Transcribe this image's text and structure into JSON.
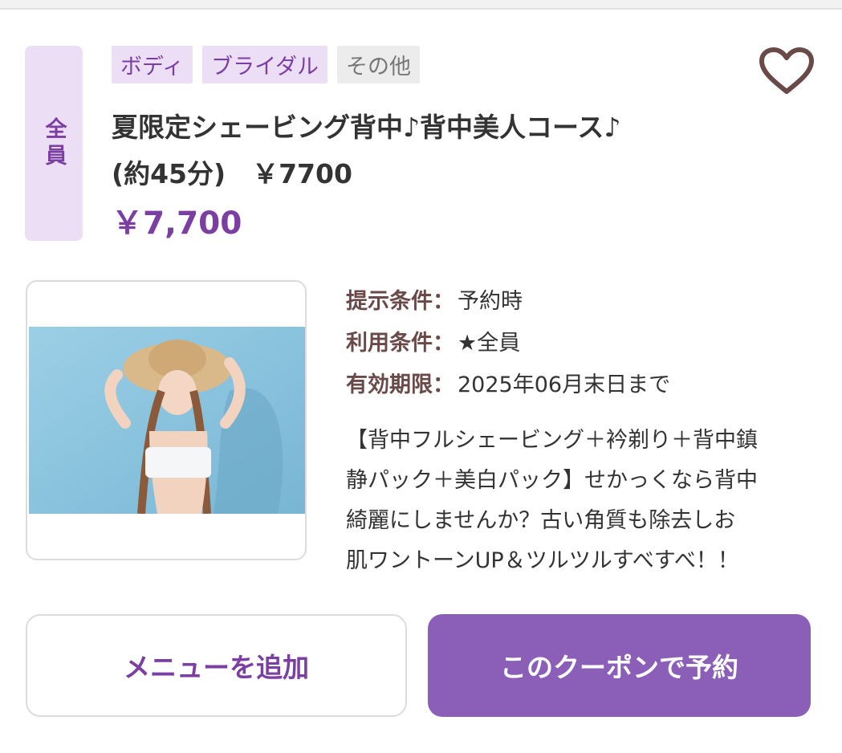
{
  "coupon": {
    "target_badge": "全員",
    "tags": [
      {
        "label": "ボディ",
        "style": "purple"
      },
      {
        "label": "ブライダル",
        "style": "purple"
      },
      {
        "label": "その他",
        "style": "gray"
      }
    ],
    "title_line1": "夏限定シェービング背中♪背中美人コース♪",
    "title_line2": "(約45分)　￥7700",
    "price": "￥7,700",
    "favorite_icon": "heart-icon",
    "conditions": [
      {
        "label": "提示条件：",
        "value": "予約時"
      },
      {
        "label": "利用条件：",
        "value": "★全員"
      },
      {
        "label": "有効期限：",
        "value": "2025年06月末日まで"
      }
    ],
    "description_lines": [
      "【背中フルシェービング＋衿剃り＋背中鎮",
      "静パック＋美白パック】せかっくなら背中",
      "綺麗にしませんか？古い角質も除去しお",
      "肌ワントーンUP＆ツルツルすべすべ！！"
    ]
  },
  "actions": {
    "add_menu_label": "メニューを追加",
    "reserve_label": "このクーポンで予約"
  },
  "colors": {
    "accent": "#7b3fa3",
    "accent_bg": "#ecdff5",
    "button_primary": "#8b5fb8",
    "heart": "#6a4a48",
    "photo_background": "#8cc6e0"
  }
}
